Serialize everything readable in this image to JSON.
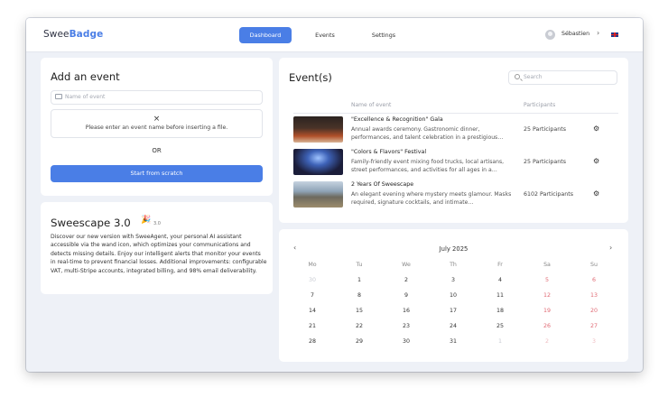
{
  "app": {
    "logo_plain": "Swee",
    "logo_accent": "Badge"
  },
  "nav": {
    "dashboard": "Dashboard",
    "events": "Events",
    "settings": "Settings"
  },
  "user": {
    "name": "Sébastien",
    "chevron": "›"
  },
  "add_event": {
    "title": "Add an event",
    "name_placeholder": "Name of event",
    "dropzone_icon": "×",
    "dropzone_message": "Please enter an event name before inserting a file.",
    "or_label": "OR",
    "scratch_button": "Start from scratch"
  },
  "promo": {
    "title": "Sweescape 3.0",
    "emoji": "🎉",
    "version": "3.0",
    "text": "Discover our new version with SweeAgent, your personal AI assistant accessible via the wand icon, which optimizes your communications and detects missing details. Enjoy our intelligent alerts that monitor your events in real-time to prevent financial losses. Additional improvements: configurable VAT, multi-Stripe accounts, integrated billing, and 98% email deliverability."
  },
  "events_panel": {
    "title": "Event(s)",
    "search_placeholder": "Search",
    "col_name": "Name of event",
    "col_participants": "Participants",
    "rows": [
      {
        "name": "\"Excellence & Recognition\" Gala",
        "desc": "Annual awards ceremony. Gastronomic dinner, performances, and talent celebration in a prestigious…",
        "participants": "25 Participants",
        "image": "gala-photo"
      },
      {
        "name": "\"Colors & Flavors\" Festival",
        "desc": "Family-friendly event mixing food trucks, local artisans, street performances, and activities for all ages in a…",
        "participants": "25 Participants",
        "image": "festival-photo"
      },
      {
        "name": "2 Years Of Sweescape",
        "desc": "An elegant evening where mystery meets glamour. Masks required, signature cocktails, and intimate…",
        "participants": "6102 Participants",
        "image": "anniversary-photo"
      }
    ]
  },
  "calendar": {
    "month": "July 2025",
    "prev": "‹",
    "next": "›",
    "dows": [
      "Mo",
      "Tu",
      "We",
      "Th",
      "Fr",
      "Sa",
      "Su"
    ],
    "weeks": [
      [
        "30",
        "1",
        "2",
        "3",
        "4",
        "5",
        "6"
      ],
      [
        "7",
        "8",
        "9",
        "10",
        "11",
        "12",
        "13"
      ],
      [
        "14",
        "15",
        "16",
        "17",
        "18",
        "19",
        "20"
      ],
      [
        "21",
        "22",
        "23",
        "24",
        "25",
        "26",
        "27"
      ],
      [
        "28",
        "29",
        "30",
        "31",
        "1",
        "2",
        "3"
      ]
    ]
  },
  "colors": {
    "accent": "#4a7ee6",
    "weekend": "#e06a74",
    "background": "#eef1f7"
  }
}
